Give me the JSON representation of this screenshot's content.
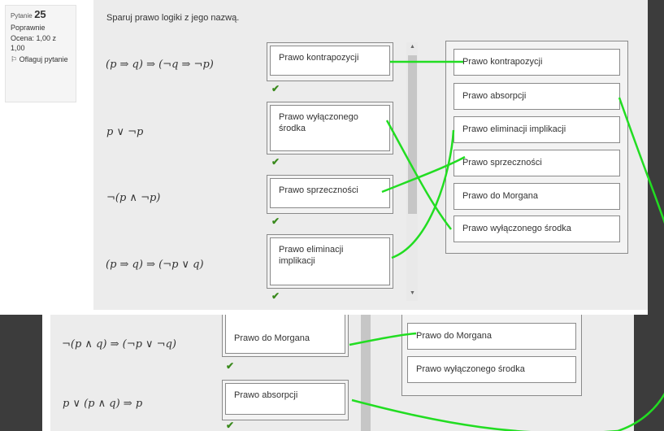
{
  "question_info": {
    "label": "Pytanie",
    "number": "25",
    "status": "Poprawnie",
    "grade": "Ocena: 1,00 z 1,00",
    "flag": "Oflaguj pytanie"
  },
  "prompt": "Sparuj prawo logiki z jego nazwą.",
  "rows": [
    {
      "formula": "(p ⇒ q) ⇒ (¬q ⇒ ¬p)",
      "answer": "Prawo kontrapozycji",
      "check": "✔"
    },
    {
      "formula": "p ∨ ¬p",
      "answer": "Prawo wyłączonego środka",
      "check": "✔"
    },
    {
      "formula": "¬(p ∧ ¬p)",
      "answer": "Prawo sprzeczności",
      "check": "✔"
    },
    {
      "formula": "(p ⇒ q) ⇒ (¬p ∨ q)",
      "answer": "Prawo eliminacji implikacji",
      "check": "✔"
    },
    {
      "formula": "¬(p ∧ q) ⇒ (¬p ∨ ¬q)",
      "answer": "Prawo do Morgana",
      "check": "✔"
    },
    {
      "formula": "p ∨ (p ∧ q) ⇒ p",
      "answer": "Prawo absorpcji",
      "check": "✔"
    }
  ],
  "options": [
    "Prawo kontrapozycji",
    "Prawo absorpcji",
    "Prawo eliminacji implikacji",
    "Prawo sprzeczności",
    "Prawo do Morgana",
    "Prawo wyłączonego środka"
  ],
  "options_lower": [
    "Prawo do Morgana",
    "Prawo wyłączonego środka"
  ],
  "scroll_up": "▲",
  "scroll_down": "▼",
  "colors": {
    "connector": "#22dd22",
    "check": "#3a8a1d"
  }
}
